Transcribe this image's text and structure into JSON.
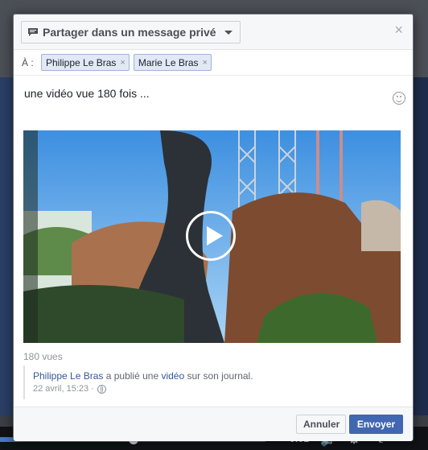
{
  "dialog": {
    "share_target_label": "Partager dans un message privé",
    "close_symbol": "×",
    "to_label": "À :",
    "recipients": [
      {
        "name": "Philippe Le Bras",
        "remove_symbol": "×"
      },
      {
        "name": "Marie Le Bras",
        "remove_symbol": "×"
      }
    ],
    "message_text": "une vidéo vue 180 fois ...",
    "emoji_icon": "smiley-icon"
  },
  "video": {
    "play_icon": "play-icon",
    "view_count": "180 vues"
  },
  "attribution": {
    "author": "Philippe Le Bras",
    "action_text": "a publié une",
    "object_link": "vidéo",
    "suffix_text": "sur son journal.",
    "timestamp": "22 avril, 15:23 ·",
    "privacy_icon": "globe-icon"
  },
  "footer": {
    "cancel_label": "Annuler",
    "send_label": "Envoyer"
  },
  "player": {
    "time_label": "-0:01"
  },
  "colors": {
    "primary_blue": "#4267b2",
    "link_blue": "#365899",
    "token_bg": "#e2e8f6",
    "token_border": "#9cb4d8"
  }
}
